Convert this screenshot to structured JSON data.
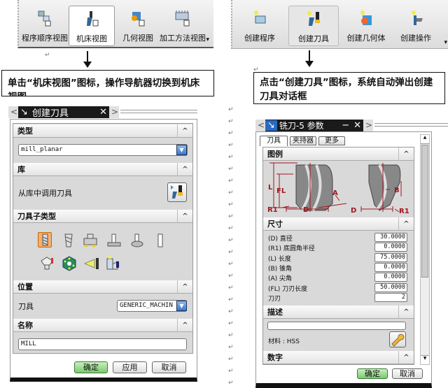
{
  "return_mark": "↵",
  "left_toolbar": {
    "buttons": [
      "程序顺序视图",
      "机床视图",
      "几何视图",
      "加工方法视图"
    ],
    "overflow": "▾"
  },
  "right_toolbar": {
    "buttons": [
      "创建程序",
      "创建刀具",
      "创建几何体",
      "创建操作"
    ],
    "overflow": "▾"
  },
  "left_callout": "单击“机床视图”图标，操作导航器切换到机床视图",
  "right_callout": "点击“创建刀具”图标，系统自动弹出创建刀具对话框",
  "create_tool_dialog": {
    "title": "创建刀具",
    "nav_prev": "<",
    "nav_next": ">",
    "close": "✕",
    "pin": "↘",
    "sections": {
      "type": "类型",
      "library": "库",
      "subtype": "刀具子类型",
      "location": "位置",
      "name": "名称"
    },
    "collapse": "^",
    "type_value": "mill_planar",
    "library_label": "从库中调用刀具",
    "location_label": "刀具",
    "location_value": "GENERIC_MACHIN",
    "name_value": "MILL",
    "buttons": {
      "ok": "确定",
      "apply": "应用",
      "cancel": "取消"
    },
    "dropdown": "▼"
  },
  "mill_params_dialog": {
    "title": "铣刀-5 参数",
    "nav_prev": "<",
    "nav_next": ">",
    "close": "✕",
    "minimize": "−",
    "pin": "↘",
    "tabs": [
      "刀具",
      "夹持器",
      "更多"
    ],
    "sections": {
      "legend": "图例",
      "dimensions": "尺寸",
      "description": "描述",
      "numbers": "数字"
    },
    "collapse": "^",
    "legend_labels": {
      "L": "L",
      "FL": "FL",
      "R1": "R1",
      "D": "D",
      "A": "A",
      "B": "B"
    },
    "params": [
      {
        "label": "(D) 直径",
        "value": "30.0000"
      },
      {
        "label": "(R1) 底圆角半径",
        "value": "0.0000"
      },
      {
        "label": "(L) 长度",
        "value": "75.0000"
      },
      {
        "label": "(B) 锥角",
        "value": "0.0000"
      },
      {
        "label": "(A) 尖角",
        "value": "0.0000"
      },
      {
        "label": "(FL) 刀刃长度",
        "value": "50.0000"
      },
      {
        "label": "刀刃",
        "value": "2"
      }
    ],
    "description_value": "",
    "material_label": "材料 : HSS",
    "buttons": {
      "ok": "确定",
      "cancel": "取消"
    },
    "scroll_up": "▲",
    "scroll_down": "▼"
  }
}
